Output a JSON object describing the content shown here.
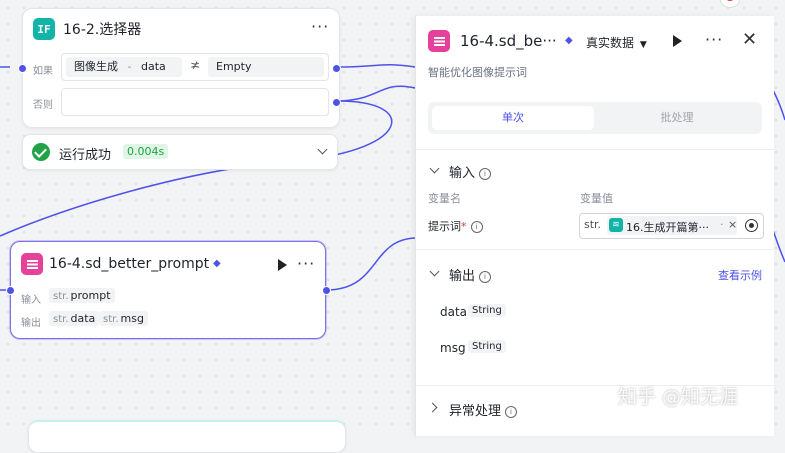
{
  "selector_node": {
    "title": "16-2.选择器",
    "if_label": "如果",
    "else_label": "否则",
    "cond_left": "图像生成",
    "cond_sep": "-",
    "cond_var": "data",
    "cond_op": "≭",
    "cond_right": "Empty"
  },
  "run_status": {
    "text": "运行成功",
    "time": "0.004s"
  },
  "prompt_node": {
    "title": "16-4.sd_better_prompt",
    "input_label": "输入",
    "output_label": "输出",
    "input_type": "str.",
    "input_name": "prompt",
    "out1_type": "str.",
    "out1_name": "data",
    "out2_type": "str.",
    "out2_name": "msg"
  },
  "panel": {
    "title": "16-4.sd_be···",
    "data_mode": "真实数据",
    "subtitle": "智能优化图像提示词",
    "tab_single": "单次",
    "tab_batch": "批处理",
    "input_section": "输入",
    "col_name": "变量名",
    "col_value": "变量值",
    "var_label": "提示词",
    "required_mark": "*",
    "var_type": "str.",
    "var_ref": "16.生成开篇第···",
    "var_ref_sep": "·",
    "var_ref_clear": "×",
    "output_section": "输出",
    "view_example": "查看示例",
    "out1_name": "data",
    "out1_type": "String",
    "out2_name": "msg",
    "out2_type": "String",
    "error_section": "异常处理"
  },
  "watermark": "知乎 @知无涯",
  "colors": {
    "accent": "#4d53e8",
    "success": "#1fa346",
    "pink": "#e6419a",
    "teal": "#12b3a8"
  }
}
